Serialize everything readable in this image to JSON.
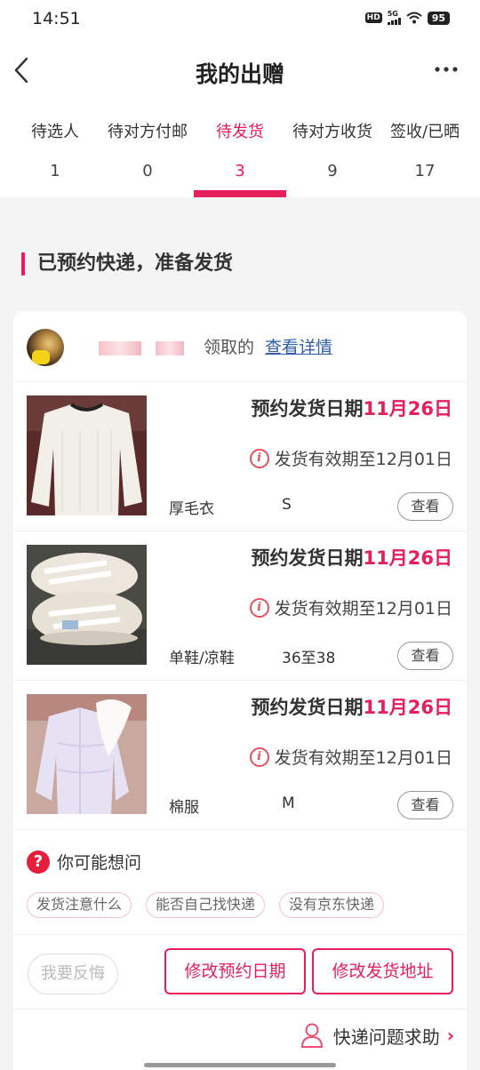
{
  "status_bar": {
    "time": "14:51",
    "hd": "HD",
    "network": "5G",
    "battery": "95"
  },
  "header": {
    "title": "我的出赠"
  },
  "tabs": [
    {
      "label": "待选人",
      "count": "1"
    },
    {
      "label": "待对方付邮",
      "count": "0"
    },
    {
      "label": "待发货",
      "count": "3",
      "active": true
    },
    {
      "label": "待对方收货",
      "count": "9"
    },
    {
      "label": "签收/已晒",
      "count": "17"
    }
  ],
  "section_title": "已预约快递，准备发货",
  "owner": {
    "text": "领取的",
    "link": "查看详情"
  },
  "items": [
    {
      "ship_label": "预约发货日期",
      "ship_date": "11月26日",
      "valid": "发货有效期至12月01日",
      "category": "厚毛衣",
      "size": "S",
      "view": "查看"
    },
    {
      "ship_label": "预约发货日期",
      "ship_date": "11月26日",
      "valid": "发货有效期至12月01日",
      "category": "单鞋/凉鞋",
      "size": "36至38",
      "view": "查看"
    },
    {
      "ship_label": "预约发货日期",
      "ship_date": "11月26日",
      "valid": "发货有效期至12月01日",
      "category": "棉服",
      "size": "M",
      "view": "查看"
    }
  ],
  "faq": {
    "title": "你可能想问",
    "chips": [
      "发货注意什么",
      "能否自己找快递",
      "没有京东快递"
    ]
  },
  "actions": {
    "regret": "我要反悔",
    "change_date": "修改预约日期",
    "change_address": "修改发货地址"
  },
  "help": {
    "label": "快递问题求助"
  },
  "colors": {
    "accent": "#e61e5a",
    "link": "#2f5da8"
  }
}
